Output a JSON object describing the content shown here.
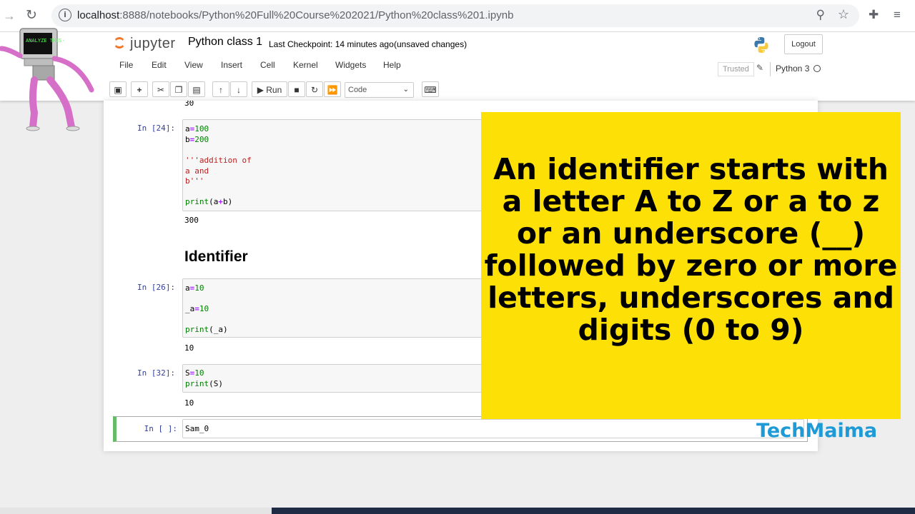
{
  "browser": {
    "url_host": "localhost",
    "url_path": ":8888/notebooks/Python%20Full%20Course%202021/Python%20class%201.ipynb"
  },
  "jupyter": {
    "logo_text": "jupyter",
    "notebook_name": "Python class 1",
    "checkpoint": "Last Checkpoint: 14 minutes ago",
    "unsaved": "(unsaved changes)",
    "logout": "Logout",
    "menu": [
      "File",
      "Edit",
      "View",
      "Insert",
      "Cell",
      "Kernel",
      "Widgets",
      "Help"
    ],
    "trusted": "Trusted",
    "kernel": "Python 3",
    "toolbar": {
      "run_label": "Run",
      "cell_type": "Code"
    }
  },
  "notebook": {
    "top_output": "30",
    "cells": [
      {
        "prompt": "In [24]:",
        "output": "300"
      },
      {
        "prompt": "In [26]:",
        "output": "10"
      },
      {
        "prompt": "In [32]:",
        "output": "10"
      },
      {
        "prompt": "In [ ]:",
        "input": "Sam_0"
      }
    ],
    "heading": "Identifier"
  },
  "overlay": {
    "text": "An identifier starts with a letter A to Z or a to z or an underscore (__) followed by zero or more letters, underscores and digits (0 to 9)",
    "brand": "TechMaima",
    "bg_color": "#fde006"
  },
  "mascot": {
    "screen_text": "ANALYZE THIS-"
  },
  "icons": [
    "forward-icon",
    "reload-icon",
    "info-icon",
    "zoom-icon",
    "star-icon",
    "extensions-icon",
    "media-icon",
    "python-logo",
    "pencil-icon"
  ]
}
